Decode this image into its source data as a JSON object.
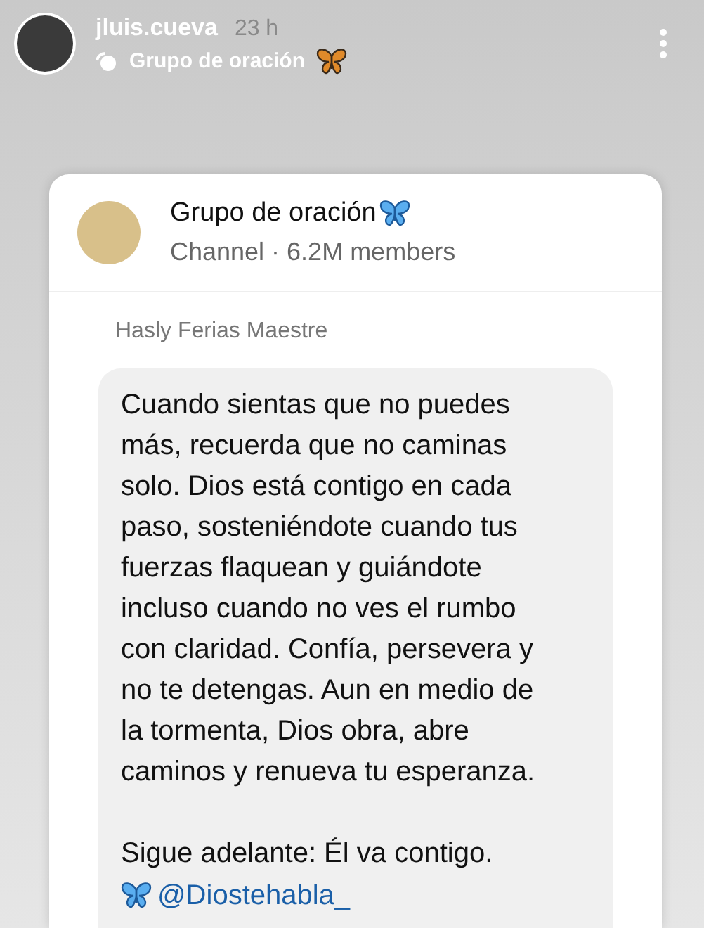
{
  "story_header": {
    "username": "jluis.cueva",
    "time": "23 h",
    "channel_label": "Grupo de oración"
  },
  "channel_card": {
    "name": "Grupo de oración",
    "subtitle": "Channel · 6.2M members",
    "message": {
      "author": "Hasly Ferias Maestre",
      "paragraphs": [
        "Cuando sientas que no puedes más, recuerda que no caminas solo. Dios está contigo en cada paso, sosteniéndote cuando tus fuerzas flaquean y guiándote incluso cuando no ves el rumbo con claridad. Confía, persevera y no te detengas. Aun en medio de la tormenta, Dios obra, abre caminos y renueva tu esperanza.",
        "Sigue adelante: Él va contigo."
      ],
      "handle": "@Diostehabla_"
    }
  }
}
